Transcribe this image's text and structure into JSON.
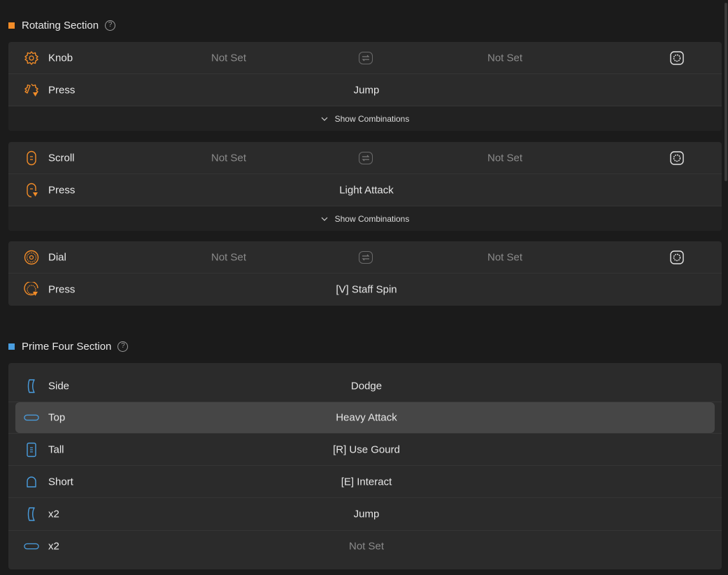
{
  "sections": {
    "rotating": {
      "title": "Rotating Section",
      "marker_color": "#f28c28",
      "help": "?",
      "groups": [
        {
          "main": {
            "icon": "knob-icon",
            "label": "Knob",
            "left": "Not Set",
            "right": "Not Set"
          },
          "press": {
            "icon": "knob-press-icon",
            "label": "Press",
            "value": "Jump"
          },
          "combo": "Show Combinations"
        },
        {
          "main": {
            "icon": "scroll-icon",
            "label": "Scroll",
            "left": "Not Set",
            "right": "Not Set"
          },
          "press": {
            "icon": "scroll-press-icon",
            "label": "Press",
            "value": "Light Attack"
          },
          "combo": "Show Combinations"
        },
        {
          "main": {
            "icon": "dial-icon",
            "label": "Dial",
            "left": "Not Set",
            "right": "Not Set"
          },
          "press": {
            "icon": "dial-press-icon",
            "label": "Press",
            "value": "[V] Staff Spin"
          }
        }
      ]
    },
    "prime_four": {
      "title": "Prime Four Section",
      "marker_color": "#4a9ee0",
      "help": "?",
      "rows": [
        {
          "icon": "side-button-icon",
          "label": "Side",
          "value": "Dodge"
        },
        {
          "icon": "top-button-icon",
          "label": "Top",
          "value": "Heavy Attack"
        },
        {
          "icon": "tall-button-icon",
          "label": "Tall",
          "value": "[R] Use Gourd"
        },
        {
          "icon": "short-button-icon",
          "label": "Short",
          "value": "[E] Interact"
        },
        {
          "icon": "side-button-icon",
          "label": "x2",
          "value": "Jump"
        },
        {
          "icon": "top-button-icon",
          "label": "x2",
          "value": "Not Set"
        }
      ]
    }
  },
  "colors": {
    "accent_orange": "#f28c28",
    "accent_blue": "#4a9ee0"
  }
}
